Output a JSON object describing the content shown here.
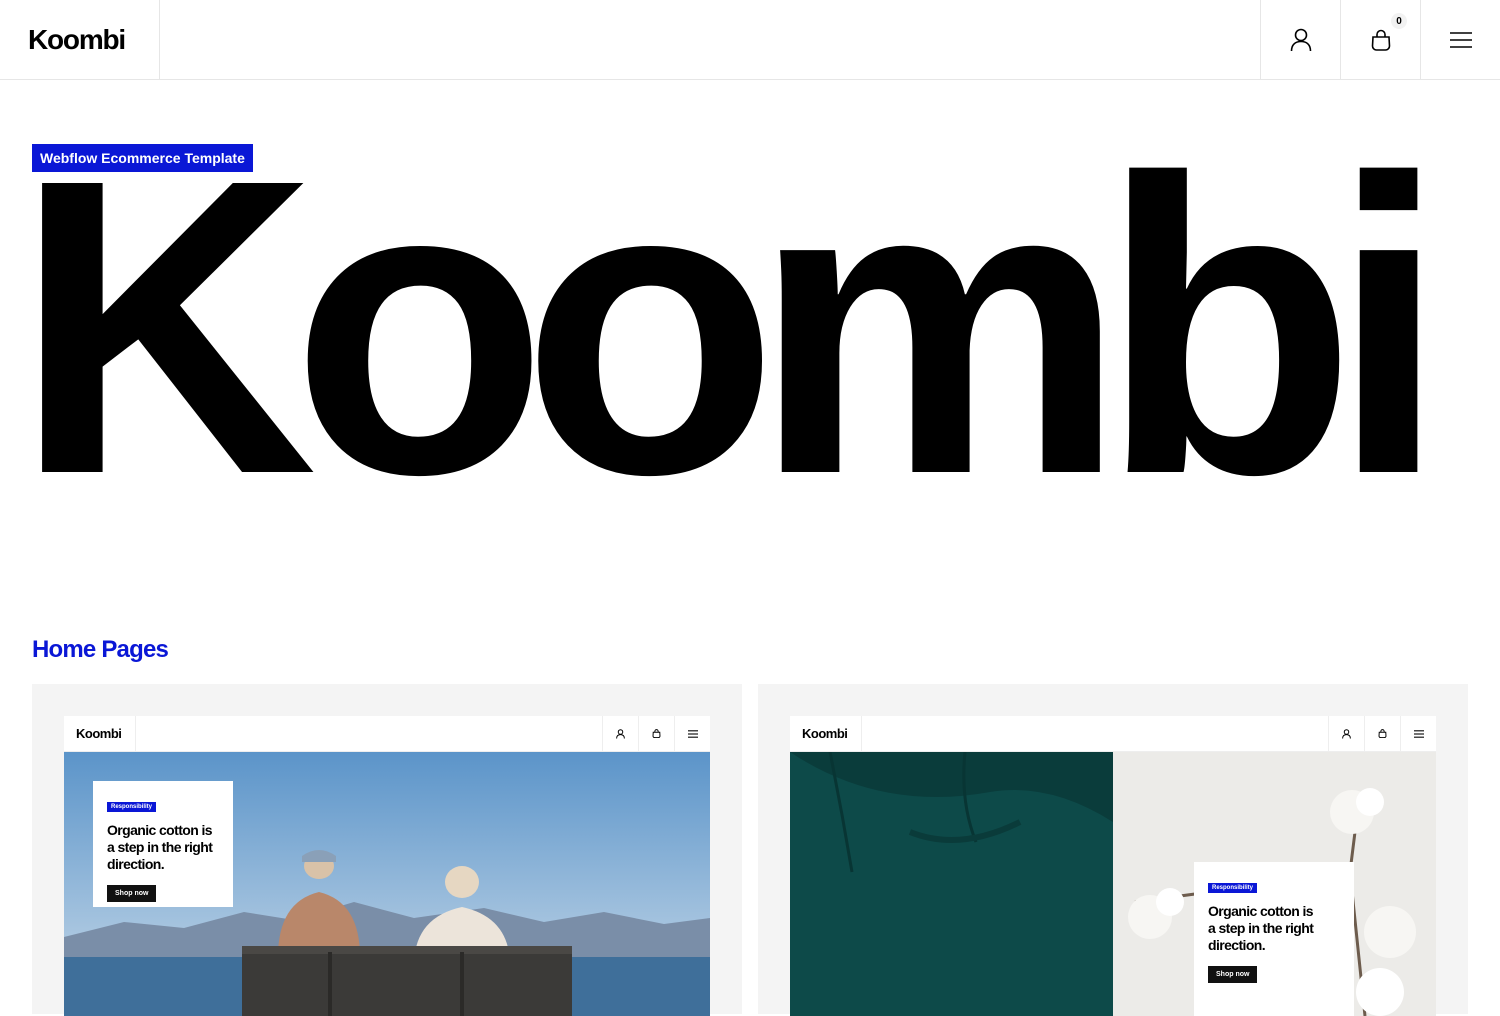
{
  "nav": {
    "logo": "Koombi",
    "cart_count": "0",
    "icons": [
      "user-icon",
      "shopping-bag-icon",
      "menu-icon"
    ]
  },
  "hero": {
    "badge": "Webflow Ecommerce Template",
    "wordmark": "Koombi"
  },
  "home_pages": {
    "title": "Home Pages",
    "cards": [
      {
        "logo": "Koombi",
        "tag": "Responsibility",
        "headline": "Organic cotton is a step in the right direction.",
        "button": "Shop now"
      },
      {
        "logo": "Koombi",
        "tag": "Responsibility",
        "headline": "Organic cotton is a step in the right direction.",
        "button": "Shop now"
      }
    ]
  },
  "colors": {
    "accent": "#0a17d6",
    "text": "#000000",
    "card_bg": "#f4f4f4",
    "border": "#e6e6e6"
  }
}
